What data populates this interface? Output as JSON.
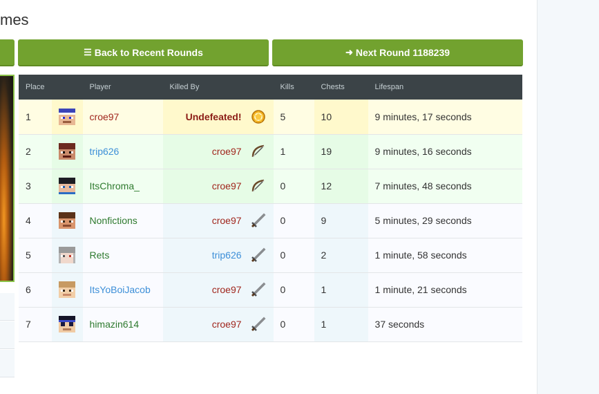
{
  "page": {
    "title": "mes"
  },
  "buttons": {
    "back": {
      "label": "Back to Recent Rounds",
      "icon": "list-icon"
    },
    "next": {
      "label": "Next Round 1188239",
      "icon": "arrow-right-icon"
    }
  },
  "colors": {
    "button_green": "#72a22f",
    "header_dark": "#3b4347",
    "winner_row": "#fffde3",
    "red_text": "#a0261d",
    "blue_text": "#3d8fd8",
    "green_text": "#2e7a2e"
  },
  "table": {
    "headers": [
      "Place",
      "",
      "Player",
      "Killed By",
      "Kills",
      "Chests",
      "Lifespan"
    ],
    "rows": [
      {
        "place": "1",
        "player": "croe97",
        "killed_by": "Undefeated!",
        "weapon": "trophy-icon",
        "kills": "5",
        "chests": "10",
        "lifespan": "9 minutes, 17 seconds"
      },
      {
        "place": "2",
        "player": "trip626",
        "killed_by": "croe97",
        "weapon": "bow-icon",
        "kills": "1",
        "chests": "19",
        "lifespan": "9 minutes, 16 seconds"
      },
      {
        "place": "3",
        "player": "ItsChroma_",
        "killed_by": "croe97",
        "weapon": "bow-icon",
        "kills": "0",
        "chests": "12",
        "lifespan": "7 minutes, 48 seconds"
      },
      {
        "place": "4",
        "player": "Nonfictions",
        "killed_by": "croe97",
        "weapon": "sword-icon",
        "kills": "0",
        "chests": "9",
        "lifespan": "5 minutes, 29 seconds"
      },
      {
        "place": "5",
        "player": "Rets",
        "killed_by": "trip626",
        "weapon": "sword-icon",
        "kills": "0",
        "chests": "2",
        "lifespan": "1 minute, 58 seconds"
      },
      {
        "place": "6",
        "player": "ItsYoBoiJacob",
        "killed_by": "croe97",
        "weapon": "sword-icon",
        "kills": "0",
        "chests": "1",
        "lifespan": "1 minute, 21 seconds"
      },
      {
        "place": "7",
        "player": "himazin614",
        "killed_by": "croe97",
        "weapon": "sword-icon",
        "kills": "0",
        "chests": "1",
        "lifespan": "37 seconds"
      }
    ]
  }
}
